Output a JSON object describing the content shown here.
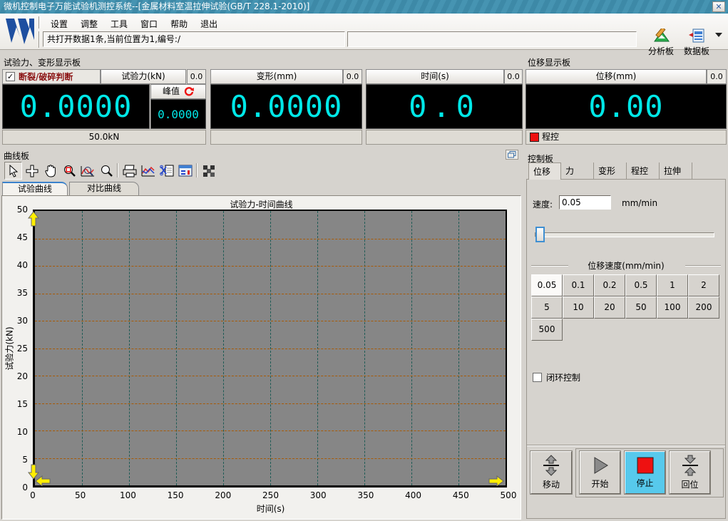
{
  "window": {
    "title": "微机控制电子万能试验机测控系统--[金属材料室温拉伸试验(GB/T 228.1-2010)]",
    "close_glyph": "✕"
  },
  "menu": {
    "items": [
      "设置",
      "调整",
      "工具",
      "窗口",
      "帮助",
      "退出"
    ]
  },
  "toolbar": {
    "status_text": "共打开数据1条,当前位置为1,编号:/",
    "analysis_label": "分析板",
    "data_label": "数据板"
  },
  "display": {
    "left_title": "试验力、变形显示板",
    "right_title": "位移显示板",
    "force": {
      "break_label": "断裂/破碎判断",
      "break_checked": "✓",
      "header": "试验力(kN)",
      "header_value": "0.0",
      "value": "0.0000",
      "peak_label": "峰值",
      "peak_value": "0.0000",
      "range": "50.0kN"
    },
    "deform": {
      "header": "变形(mm)",
      "header_value": "0.0",
      "value": "0.0000"
    },
    "time": {
      "header": "时间(s)",
      "header_value": "0.0",
      "value": "0.0"
    },
    "disp": {
      "header": "位移(mm)",
      "header_value": "0.0",
      "value": "0.00",
      "mode_label": "程控"
    }
  },
  "curve": {
    "title": "曲线板",
    "tabs": [
      {
        "label": "试验曲线",
        "active": true
      },
      {
        "label": "对比曲线",
        "active": false
      }
    ],
    "toolbar_icons": [
      "pointer-icon",
      "move-cross-icon",
      "hand-pan-icon",
      "zoom-box-icon",
      "zoom-curve-icon",
      "magnifier-icon",
      "print-icon",
      "curve-export-icon",
      "cut-page-icon",
      "report-panel-icon",
      "grid-pattern-icon"
    ]
  },
  "chart_data": {
    "type": "line",
    "title": "试验力-时间曲线",
    "xlabel": "时间(s)",
    "ylabel": "试验力(kN)",
    "xlim": [
      0,
      500
    ],
    "ylim": [
      0,
      50
    ],
    "x_ticks": [
      "0",
      "50",
      "100",
      "150",
      "200",
      "250",
      "300",
      "350",
      "400",
      "450",
      "500"
    ],
    "y_ticks": [
      "50",
      "45",
      "40",
      "35",
      "30",
      "25",
      "20",
      "15",
      "10",
      "5",
      "0"
    ],
    "grid": true,
    "legend": false,
    "series": []
  },
  "control": {
    "title": "控制板",
    "tabs": [
      {
        "label": "位移",
        "active": true
      },
      {
        "label": "力",
        "active": false
      },
      {
        "label": "变形",
        "active": false
      },
      {
        "label": "程控",
        "active": false
      },
      {
        "label": "拉伸",
        "active": false
      }
    ],
    "speed_label": "速度:",
    "speed_value": "0.05",
    "speed_unit": "mm/min",
    "group_label": "位移速度(mm/min)",
    "speed_buttons": [
      "0.05",
      "0.1",
      "0.2",
      "0.5",
      "1",
      "2",
      "5",
      "10",
      "20",
      "50",
      "100",
      "200",
      "500"
    ],
    "selected_speed": "0.05",
    "closed_loop_label": "闭环控制",
    "buttons": {
      "move": "移动",
      "start": "开始",
      "stop": "停止",
      "return": "回位"
    }
  },
  "colors": {
    "titlebar": "#3f8fae",
    "lcd_digits": "#00e8e8",
    "break_text": "#8b1313",
    "plot_bg": "#868686",
    "hgrid": "#a85a06",
    "vgrid": "#1d5b55",
    "stop_button_bg": "#57c9ec",
    "stop_square": "#ee1111",
    "marker": "#ffee00"
  }
}
